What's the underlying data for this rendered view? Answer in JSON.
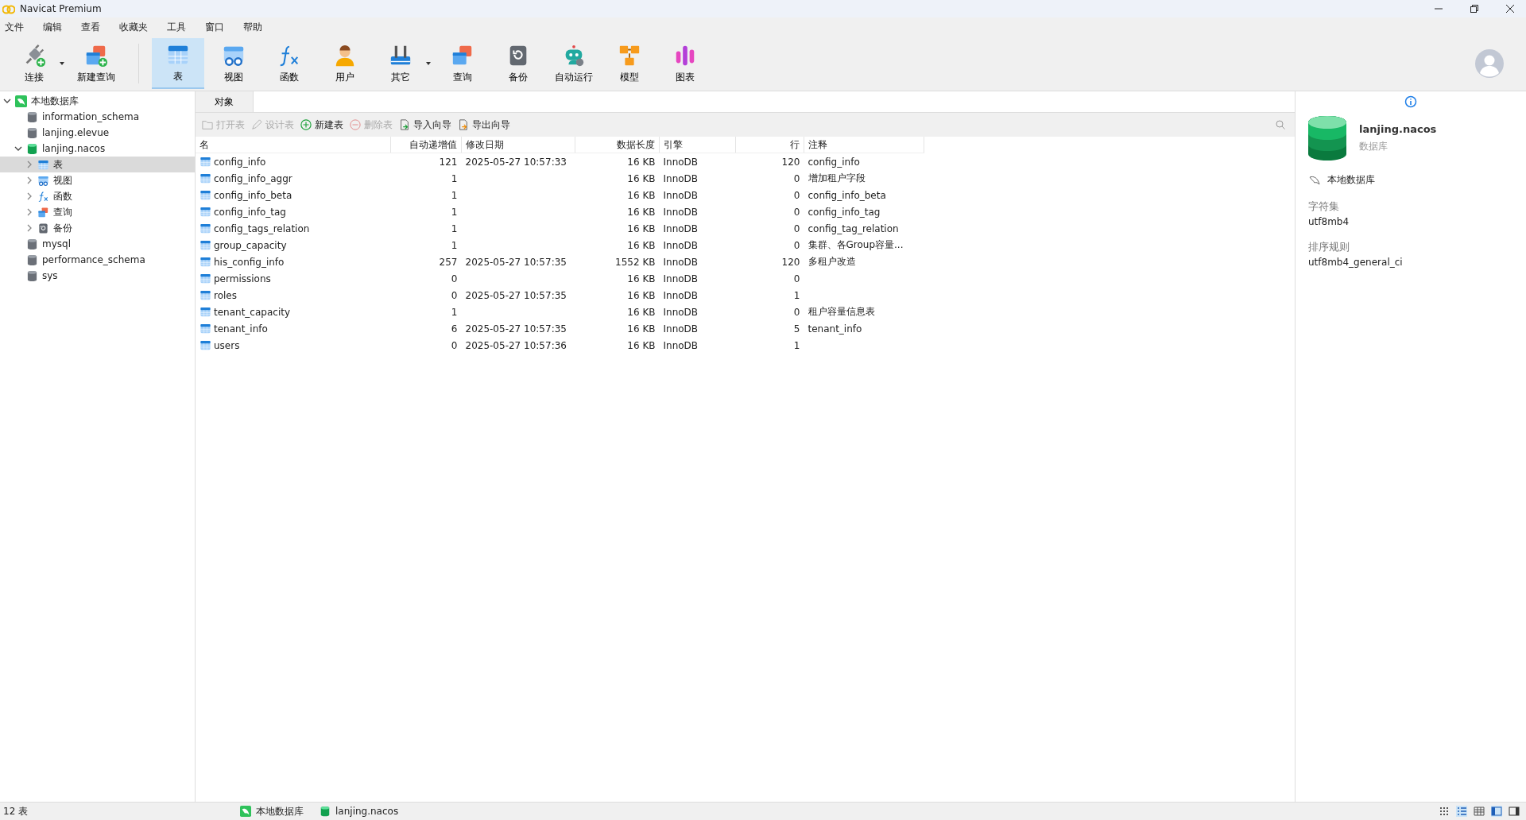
{
  "window": {
    "title": "Navicat Premium"
  },
  "menu": [
    "文件",
    "编辑",
    "查看",
    "收藏夹",
    "工具",
    "窗口",
    "帮助"
  ],
  "toolbar": [
    {
      "label": "连接",
      "kind": "connect",
      "dropdown": true,
      "selected": false
    },
    {
      "label": "新建查询",
      "kind": "newquery",
      "dropdown": false,
      "selected": false
    },
    {
      "label": "表",
      "kind": "table",
      "dropdown": false,
      "selected": true
    },
    {
      "label": "视图",
      "kind": "view",
      "dropdown": false,
      "selected": false
    },
    {
      "label": "函数",
      "kind": "function",
      "dropdown": false,
      "selected": false
    },
    {
      "label": "用户",
      "kind": "user",
      "dropdown": false,
      "selected": false
    },
    {
      "label": "其它",
      "kind": "other",
      "dropdown": true,
      "selected": false
    },
    {
      "label": "查询",
      "kind": "query",
      "dropdown": false,
      "selected": false
    },
    {
      "label": "备份",
      "kind": "backup",
      "dropdown": false,
      "selected": false
    },
    {
      "label": "自动运行",
      "kind": "robot",
      "dropdown": false,
      "selected": false
    },
    {
      "label": "模型",
      "kind": "model",
      "dropdown": false,
      "selected": false
    },
    {
      "label": "图表",
      "kind": "chart",
      "dropdown": false,
      "selected": false
    }
  ],
  "sidebar": {
    "tree": [
      {
        "label": "本地数据库",
        "kind": "connection",
        "expanded": true,
        "children": [
          {
            "label": "information_schema",
            "kind": "db",
            "selected": false
          },
          {
            "label": "lanjing.elevue",
            "kind": "db",
            "selected": false
          },
          {
            "label": "lanjing.nacos",
            "kind": "dbopen",
            "expanded": true,
            "selected": false,
            "children": [
              {
                "label": "表",
                "kind": "table",
                "expanded": false,
                "selected": true
              },
              {
                "label": "视图",
                "kind": "view",
                "expanded": false,
                "selected": false
              },
              {
                "label": "函数",
                "kind": "function",
                "expanded": false,
                "selected": false
              },
              {
                "label": "查询",
                "kind": "query",
                "expanded": false,
                "selected": false
              },
              {
                "label": "备份",
                "kind": "backup",
                "expanded": false,
                "selected": false
              }
            ]
          },
          {
            "label": "mysql",
            "kind": "db",
            "selected": false
          },
          {
            "label": "performance_schema",
            "kind": "db",
            "selected": false
          },
          {
            "label": "sys",
            "kind": "db",
            "selected": false
          }
        ]
      }
    ]
  },
  "tabs": [
    {
      "label": "对象",
      "selected": true
    }
  ],
  "object_toolbar": [
    {
      "label": "打开表",
      "kind": "open",
      "disabled": true
    },
    {
      "label": "设计表",
      "kind": "design",
      "disabled": true
    },
    {
      "label": "新建表",
      "kind": "new",
      "disabled": false
    },
    {
      "label": "删除表",
      "kind": "delete",
      "disabled": true
    },
    {
      "label": "导入向导",
      "kind": "import",
      "disabled": false
    },
    {
      "label": "导出向导",
      "kind": "export",
      "disabled": false
    }
  ],
  "table": {
    "columns": [
      "名",
      "自动递增值",
      "修改日期",
      "数据长度",
      "引擎",
      "行",
      "注释"
    ],
    "rows": [
      [
        "config_info",
        "121",
        "2025-05-27 10:57:33",
        "16 KB",
        "InnoDB",
        "120",
        "config_info"
      ],
      [
        "config_info_aggr",
        "1",
        "",
        "16 KB",
        "InnoDB",
        "0",
        "增加租户字段"
      ],
      [
        "config_info_beta",
        "1",
        "",
        "16 KB",
        "InnoDB",
        "0",
        "config_info_beta"
      ],
      [
        "config_info_tag",
        "1",
        "",
        "16 KB",
        "InnoDB",
        "0",
        "config_info_tag"
      ],
      [
        "config_tags_relation",
        "1",
        "",
        "16 KB",
        "InnoDB",
        "0",
        "config_tag_relation"
      ],
      [
        "group_capacity",
        "1",
        "",
        "16 KB",
        "InnoDB",
        "0",
        "集群、各Group容量..."
      ],
      [
        "his_config_info",
        "257",
        "2025-05-27 10:57:35",
        "1552 KB",
        "InnoDB",
        "120",
        "多租户改造"
      ],
      [
        "permissions",
        "0",
        "",
        "16 KB",
        "InnoDB",
        "0",
        ""
      ],
      [
        "roles",
        "0",
        "2025-05-27 10:57:35",
        "16 KB",
        "InnoDB",
        "1",
        ""
      ],
      [
        "tenant_capacity",
        "1",
        "",
        "16 KB",
        "InnoDB",
        "0",
        "租户容量信息表"
      ],
      [
        "tenant_info",
        "6",
        "2025-05-27 10:57:35",
        "16 KB",
        "InnoDB",
        "5",
        "tenant_info"
      ],
      [
        "users",
        "0",
        "2025-05-27 10:57:36",
        "16 KB",
        "InnoDB",
        "1",
        ""
      ]
    ]
  },
  "info_panel": {
    "name": "lanjing.nacos",
    "type": "数据库",
    "connection": "本地数据库",
    "fields": [
      {
        "label": "字符集",
        "value": "utf8mb4"
      },
      {
        "label": "排序规则",
        "value": "utf8mb4_general_ci"
      }
    ]
  },
  "status_bar": {
    "count": "12 表",
    "tabs": [
      {
        "label": "本地数据库",
        "kind": "connection"
      },
      {
        "label": "lanjing.nacos",
        "kind": "dbopen"
      }
    ]
  }
}
